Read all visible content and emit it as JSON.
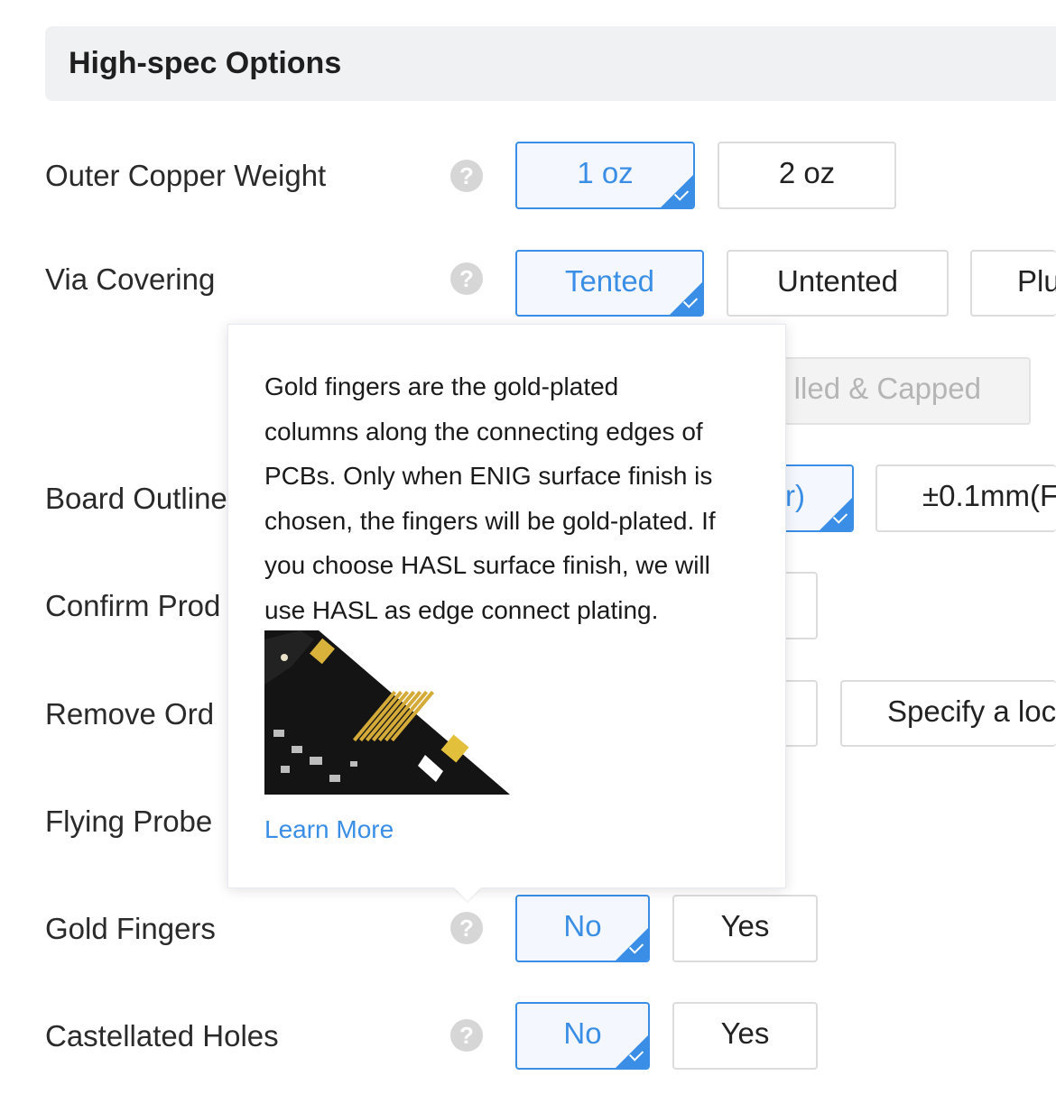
{
  "section": {
    "title": "High-spec Options"
  },
  "rows": {
    "outer_copper": {
      "label": "Outer Copper Weight",
      "options": [
        "1 oz",
        "2 oz"
      ],
      "selected": "1 oz"
    },
    "via_covering": {
      "label": "Via Covering",
      "options": [
        "Tented",
        "Untented",
        "Plu",
        "lled & Capped"
      ],
      "selected": "Tented"
    },
    "board_outline": {
      "label": "Board Outline",
      "options": [
        "r)",
        "±0.1mm(F"
      ]
    },
    "confirm_prod": {
      "label": "Confirm Prod"
    },
    "remove_order": {
      "label": "Remove Ord",
      "options": [
        "Specify a loc"
      ]
    },
    "flying_probe": {
      "label": "Flying Probe"
    },
    "gold_fingers": {
      "label": "Gold Fingers",
      "options": [
        "No",
        "Yes"
      ],
      "selected": "No"
    },
    "castellated": {
      "label": "Castellated Holes",
      "options": [
        "No",
        "Yes"
      ],
      "selected": "No"
    }
  },
  "help_icon": {
    "glyph": "?",
    "icon": "question-circle-icon"
  },
  "tooltip": {
    "lines": [
      "Gold fingers are the gold-plated",
      "columns along the connecting edges of",
      "PCBs. Only when ENIG surface finish is",
      "chosen, the fingers will be gold-plated. If",
      "you choose HASL surface finish, we will",
      "use HASL as edge connect plating."
    ],
    "link": "Learn More"
  },
  "colors": {
    "accent": "#3a8ee6",
    "header_bg": "#f0f1f3",
    "help_icon": "#d6d6d6"
  }
}
